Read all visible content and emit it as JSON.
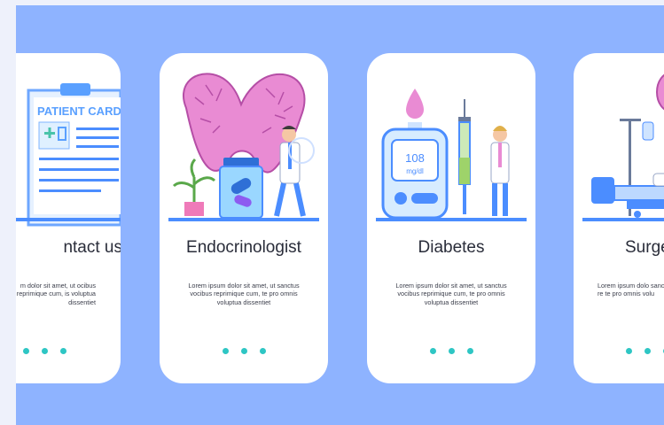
{
  "cards": [
    {
      "title": "ntact us",
      "illustration_label": "PATIENT CARD",
      "text": "m dolor sit amet, ut ocibus reprimique cum, is voluptua dissentiet"
    },
    {
      "title": "Endocrinologist",
      "text": "Lorem ipsum dolor sit amet, ut sanctus vocibus reprimique cum, te pro omnis voluptua dissentiet"
    },
    {
      "title": "Diabetes",
      "illustration_reading": "108",
      "illustration_unit": "mg/dl",
      "text": "Lorem ipsum dolor sit amet, ut sanctus vocibus reprimique cum, te pro omnis voluptua dissentiet"
    },
    {
      "title": "Surge",
      "text": "Lorem ipsum dolo sanctus vocibus re te pro omnis volu"
    }
  ],
  "colors": {
    "background": "#8eb3ff",
    "card": "#ffffff",
    "dot": "#2ec6c4",
    "thyroid": "#e98bd3",
    "accent_blue": "#4b8dff"
  }
}
